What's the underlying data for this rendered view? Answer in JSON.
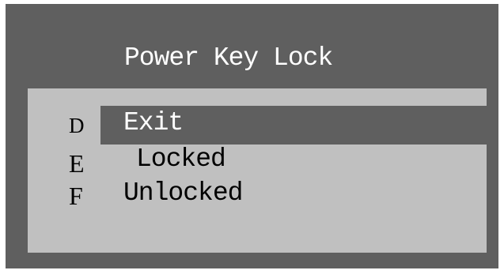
{
  "menu": {
    "title": "Power Key Lock",
    "items": [
      {
        "key": "D",
        "label": "Exit",
        "selected": true
      },
      {
        "key": "E",
        "label": "Locked",
        "selected": false
      },
      {
        "key": "F",
        "label": "Unlocked",
        "selected": false
      }
    ]
  },
  "colors": {
    "screen_background": "#5f5f5f",
    "panel_background": "#c0c0c0",
    "highlight_background": "#5f5f5f",
    "highlight_text": "#ffffff",
    "normal_text": "#000000"
  }
}
